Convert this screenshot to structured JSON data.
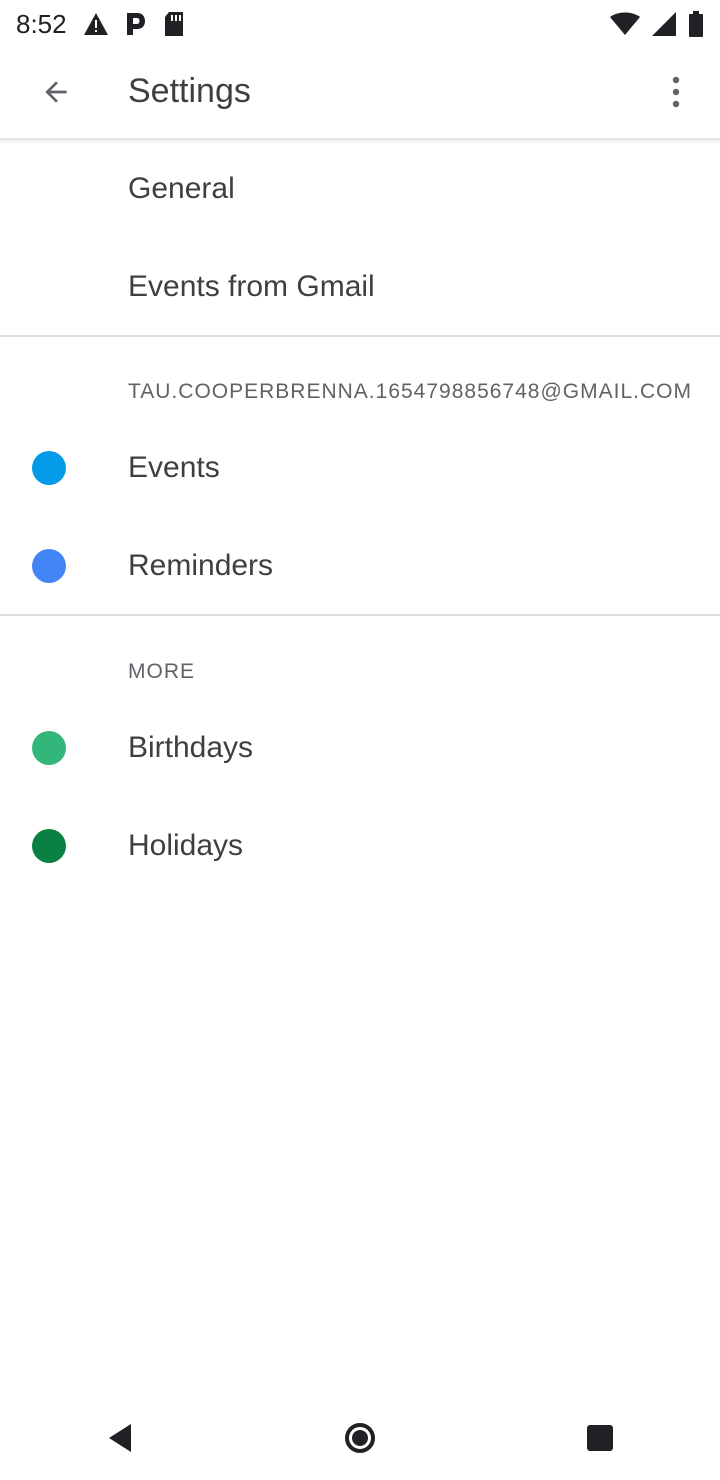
{
  "status_bar": {
    "time": "8:52",
    "icons_left": [
      "alert-icon",
      "p-icon",
      "sd-card-icon"
    ],
    "icons_right": [
      "wifi-icon",
      "signal-icon",
      "battery-icon"
    ]
  },
  "app_bar": {
    "title": "Settings",
    "back_icon": "arrow-back-icon",
    "overflow_icon": "more-vert-icon"
  },
  "top_items": [
    {
      "label": "General"
    },
    {
      "label": "Events from Gmail"
    }
  ],
  "account_section": {
    "header": "TAU.COOPERBRENNA.1654798856748@GMAIL.COM",
    "items": [
      {
        "label": "Events",
        "color": "#039be5"
      },
      {
        "label": "Reminders",
        "color": "#4285f4"
      }
    ]
  },
  "more_section": {
    "header": "MORE",
    "items": [
      {
        "label": "Birthdays",
        "color": "#33b679"
      },
      {
        "label": "Holidays",
        "color": "#0b8043"
      }
    ]
  },
  "nav_bar": {
    "icons": [
      "nav-back-icon",
      "nav-home-icon",
      "nav-recents-icon"
    ]
  }
}
